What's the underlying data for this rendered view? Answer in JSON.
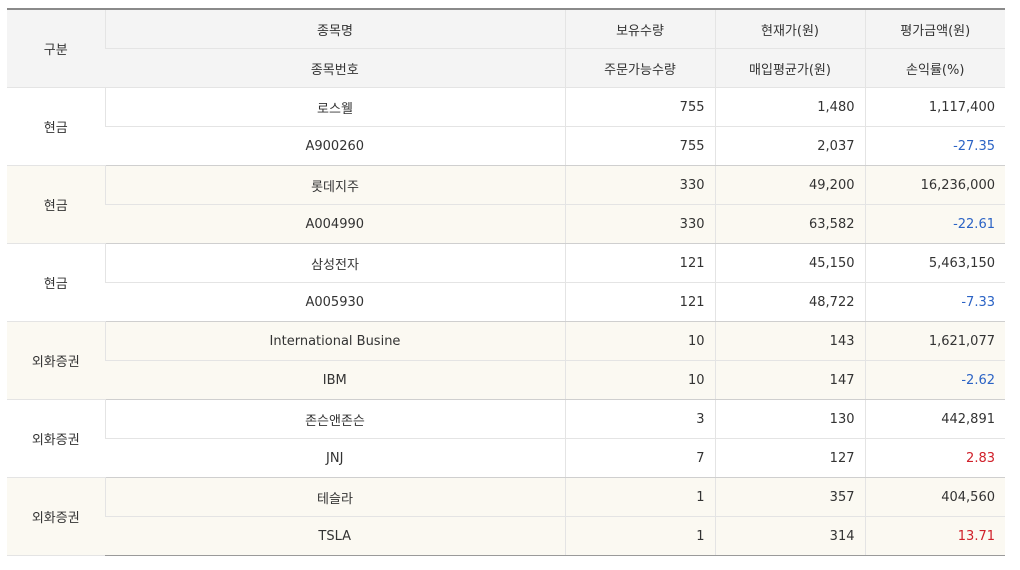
{
  "header": {
    "row1": [
      "구분",
      "종목명",
      "보유수량",
      "현재가(원)",
      "평가금액(원)"
    ],
    "row2": [
      "종목번호",
      "주문가능수량",
      "매입평균가(원)",
      "손익률(%)"
    ]
  },
  "holdings": [
    {
      "category": "현금",
      "name": "로스웰",
      "code": "A900260",
      "qty": "755",
      "order_qty": "755",
      "price": "1,480",
      "avg_price": "2,037",
      "value": "1,117,400",
      "pnl": "-27.35",
      "pnl_sign": "neg"
    },
    {
      "category": "현금",
      "name": "롯데지주",
      "code": "A004990",
      "qty": "330",
      "order_qty": "330",
      "price": "49,200",
      "avg_price": "63,582",
      "value": "16,236,000",
      "pnl": "-22.61",
      "pnl_sign": "neg"
    },
    {
      "category": "현금",
      "name": "삼성전자",
      "code": "A005930",
      "qty": "121",
      "order_qty": "121",
      "price": "45,150",
      "avg_price": "48,722",
      "value": "5,463,150",
      "pnl": "-7.33",
      "pnl_sign": "neg"
    },
    {
      "category": "외화증권",
      "name": "International Busine",
      "code": "IBM",
      "qty": "10",
      "order_qty": "10",
      "price": "143",
      "avg_price": "147",
      "value": "1,621,077",
      "pnl": "-2.62",
      "pnl_sign": "neg"
    },
    {
      "category": "외화증권",
      "name": "존슨앤존슨",
      "code": "JNJ",
      "qty": "3",
      "order_qty": "7",
      "price": "130",
      "avg_price": "127",
      "value": "442,891",
      "pnl": "2.83",
      "pnl_sign": "pos"
    },
    {
      "category": "외화증권",
      "name": "테슬라",
      "code": "TSLA",
      "qty": "1",
      "order_qty": "1",
      "price": "357",
      "avg_price": "314",
      "value": "404,560",
      "pnl": "13.71",
      "pnl_sign": "pos"
    }
  ],
  "colors": {
    "negative": "#2b63c5",
    "positive": "#d0202a",
    "header_bg": "#f4f4f4",
    "alt_row_bg": "#fbf9f2"
  }
}
